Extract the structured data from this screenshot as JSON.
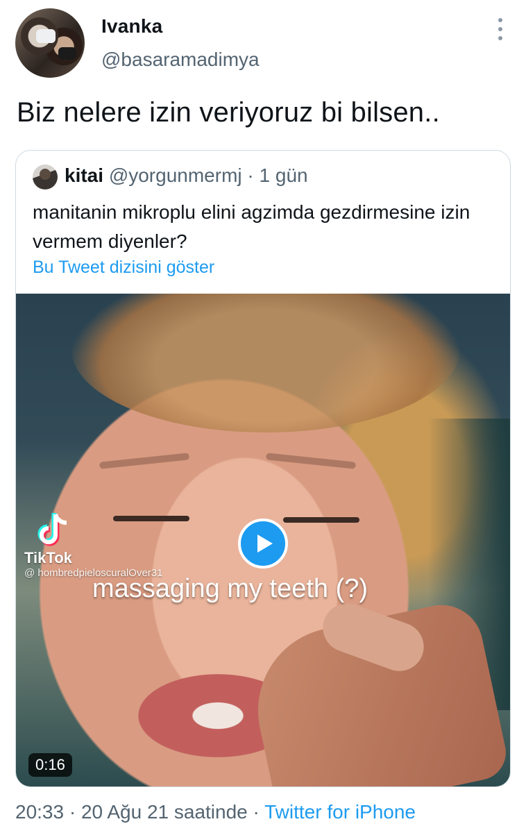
{
  "author": {
    "display_name": "Ivanka",
    "handle": "@basaramadimya"
  },
  "tweet": {
    "text": "Biz nelere izin veriyoruz bi bilsen.."
  },
  "quoted_tweet": {
    "display_name": "kitai",
    "handle": "@yorgunmermj",
    "separator": "·",
    "time": "1 gün",
    "text": "manitanin mikroplu elini agzimda gezdirmesine izin vermem diyenler?",
    "thread_link": "Bu Tweet dizisini göster",
    "video": {
      "watermark_label": "TikTok",
      "watermark_user": "@ hombredpieloscuralOver31",
      "caption": "massaging my teeth (?)",
      "duration": "0:16"
    }
  },
  "footer": {
    "time": "20:33",
    "separator1": " · ",
    "date": "20 Ağu 21 saatinde",
    "separator2": " · ",
    "source": "Twitter for iPhone"
  },
  "colors": {
    "link": "#1d9bf0",
    "secondary_text": "#536471",
    "border": "#cfd9de"
  },
  "icons": [
    "more-icon",
    "play-icon",
    "tiktok-logo-icon"
  ]
}
